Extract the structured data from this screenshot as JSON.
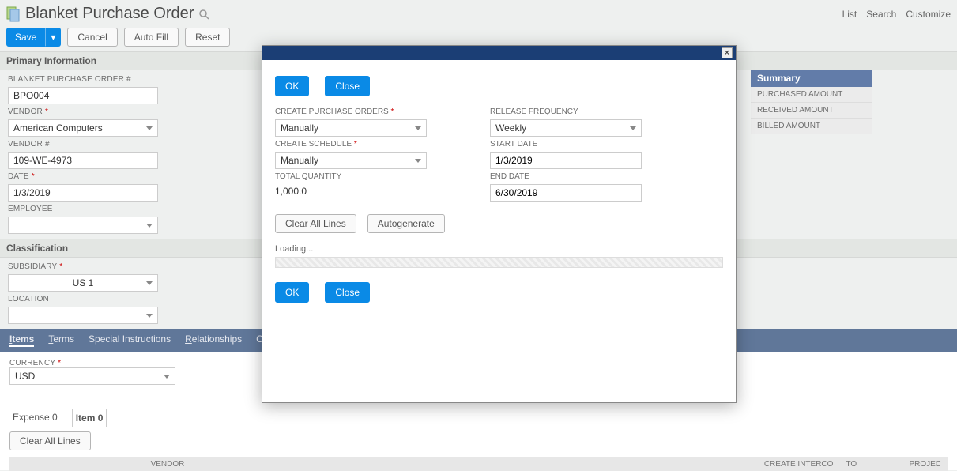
{
  "header": {
    "title": "Blanket Purchase Order",
    "links": [
      "List",
      "Search",
      "Customize"
    ]
  },
  "actions": {
    "save": "Save",
    "cancel": "Cancel",
    "autofill": "Auto Fill",
    "reset": "Reset"
  },
  "sections": {
    "primary": "Primary Information",
    "classification": "Classification"
  },
  "primary": {
    "bpo_label": "BLANKET PURCHASE ORDER #",
    "bpo_value": "BPO004",
    "vendor_label": "VENDOR",
    "vendor_value": "American Computers",
    "vendornum_label": "VENDOR #",
    "vendornum_value": "109-WE-4973",
    "date_label": "DATE",
    "date_value": "1/3/2019",
    "employee_label": "EMPLOYEE",
    "employee_value": ""
  },
  "classification": {
    "subsidiary_label": "SUBSIDIARY",
    "subsidiary_value": "US 1",
    "location_label": "LOCATION",
    "location_value": ""
  },
  "summary": {
    "head": "Summary",
    "rows": [
      "PURCHASED AMOUNT",
      "RECEIVED AMOUNT",
      "BILLED AMOUNT"
    ]
  },
  "tabs": [
    "Items",
    "Terms",
    "Special Instructions",
    "Relationships",
    "Commun"
  ],
  "items": {
    "currency_label": "CURRENCY",
    "currency_value": "USD",
    "subtabs": [
      "Expense 0",
      "Item 0"
    ],
    "clear_lines": "Clear All Lines",
    "cols": {
      "vendor": "VENDOR",
      "interco": "CREATE INTERCO",
      "to": "TO",
      "project": "PROJEC"
    }
  },
  "modal": {
    "ok": "OK",
    "close": "Close",
    "cpo_label": "CREATE PURCHASE ORDERS",
    "cpo_value": "Manually",
    "sched_label": "CREATE SCHEDULE",
    "sched_value": "Manually",
    "totqty_label": "TOTAL QUANTITY",
    "totqty_value": "1,000.0",
    "freq_label": "RELEASE FREQUENCY",
    "freq_value": "Weekly",
    "start_label": "START DATE",
    "start_value": "1/3/2019",
    "end_label": "END DATE",
    "end_value": "6/30/2019",
    "clear_lines": "Clear All Lines",
    "autogen": "Autogenerate",
    "loading": "Loading..."
  }
}
